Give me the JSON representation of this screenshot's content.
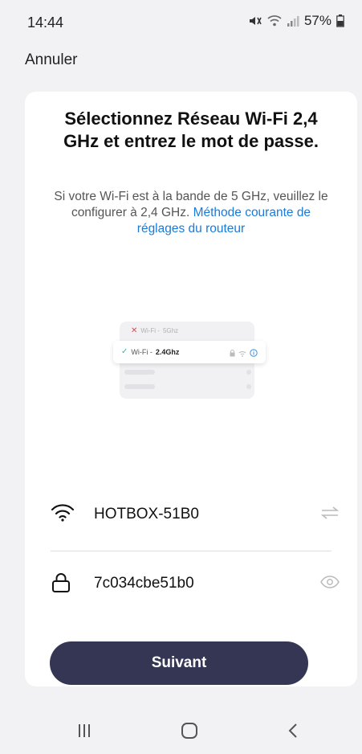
{
  "status_bar": {
    "time": "14:44",
    "battery": "57%",
    "icons": [
      "mute-icon",
      "wifi-icon",
      "signal-icon",
      "battery-icon"
    ]
  },
  "header": {
    "cancel_label": "Annuler"
  },
  "card": {
    "title": "Sélectionnez Réseau Wi-Fi 2,4 GHz et entrez le mot de passe.",
    "subtitle_text": "Si votre Wi-Fi est à  la bande de 5 GHz, veuillez le configurer à 2,4 GHz. ",
    "subtitle_link": "Méthode courante de réglages du routeur",
    "illustration": {
      "row1_prefix": "Wi-Fi - ",
      "row1_band": "5Ghz",
      "row2_prefix": "Wi-Fi - ",
      "row2_band": "2.4Ghz"
    },
    "network": {
      "ssid": "HOTBOX-51B0",
      "icon": "wifi-icon",
      "action_icon": "switch-network-icon"
    },
    "password": {
      "value": "7c034cbe51b0",
      "icon": "lock-icon",
      "action_icon": "eye-icon"
    },
    "next_label": "Suivant"
  },
  "nav_bar": {
    "buttons": [
      "recent-apps-icon",
      "home-icon",
      "back-icon"
    ]
  },
  "colors": {
    "primary_button": "#343653",
    "link": "#1a7ad9",
    "background": "#f2f2f4",
    "card": "#ffffff"
  }
}
